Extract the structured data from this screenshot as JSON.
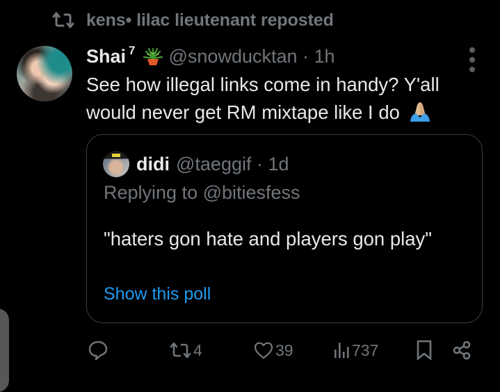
{
  "repost_header": {
    "text": "kens• lilac lieutenant reposted",
    "icon": "repost-icon"
  },
  "tweet": {
    "author_name": "Shai",
    "author_superscript": "7",
    "author_emoji": "potted-plant-icon",
    "author_handle_line": "@snowducktan · 1h",
    "text": "See how illegal links come in handy? Y'all would never get RM mixtape like I do",
    "trailing_emoji": "folded-hands-icon",
    "more_icon": "more-vertical-icon"
  },
  "quote": {
    "author_name": "didi",
    "author_handle_line": "@taeggif · 1d",
    "replying_to": "Replying to @bitiesfess",
    "text": "\"haters gon hate and players gon play\"",
    "poll_link": "Show this poll"
  },
  "actions": {
    "reply_count": "",
    "repost_count": "4",
    "like_count": "39",
    "view_count": "737"
  },
  "colors": {
    "background": "#000000",
    "text_primary": "#e7e9ea",
    "text_secondary": "#71767b",
    "link": "#1d9bf0",
    "border": "#3a3e42"
  }
}
